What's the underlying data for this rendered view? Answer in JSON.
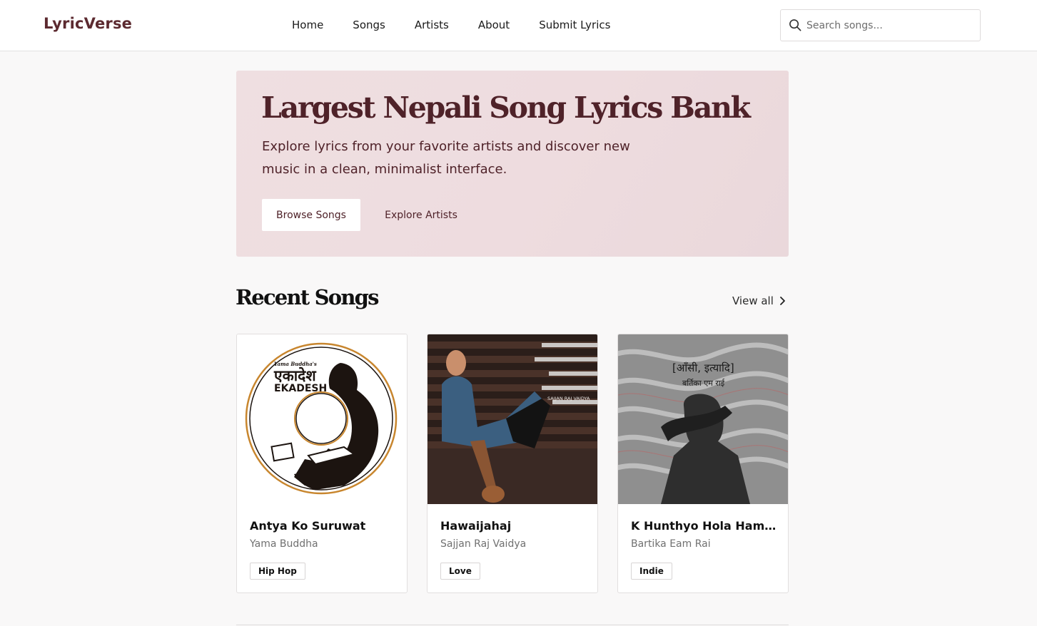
{
  "nav": {
    "logo": "LyricVerse",
    "links": [
      "Home",
      "Songs",
      "Artists",
      "About",
      "Submit Lyrics"
    ],
    "search_placeholder": "Search songs..."
  },
  "hero": {
    "title": "Largest Nepali Song Lyrics Bank",
    "subtitle": "Explore lyrics from your favorite artists and discover new music in a clean, minimalist interface.",
    "primary_button": "Browse Songs",
    "secondary_button": "Explore Artists"
  },
  "recent": {
    "title": "Recent Songs",
    "view_all": "View all",
    "songs": [
      {
        "title": "Antya Ko Suruwat",
        "artist": "Yama Buddha",
        "genre": "Hip Hop",
        "cover_text_1": "Yama Buddha's",
        "cover_text_2": "एकादेश",
        "cover_text_3": "EKADESH"
      },
      {
        "title": "Hawaijahaj",
        "artist": "Sajjan Raj Vaidya",
        "genre": "Love",
        "cover_text_1": "SAJJAN RAJ VAIDYA"
      },
      {
        "title": "K Hunthyo Hola Hami...",
        "artist": "Bartika Eam Rai",
        "genre": "Indie",
        "cover_text_1": "[आँसी, इत्यादि]",
        "cover_text_2": "बर्तिका एम राई"
      }
    ]
  },
  "colors": {
    "brand": "#5c2a30",
    "hero_bg": "#eedcdf",
    "page_bg": "#f9f8f8"
  }
}
